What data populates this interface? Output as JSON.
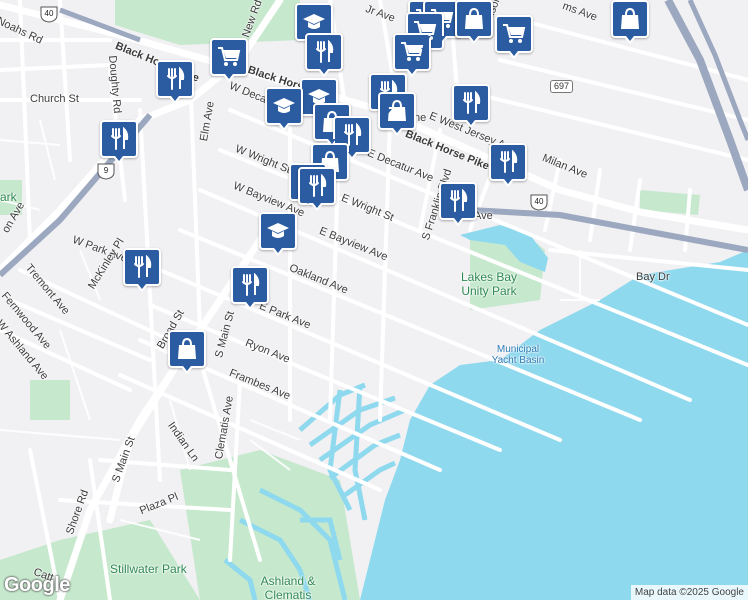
{
  "map": {
    "attribution": "Map data ©2025 Google",
    "logo": "Google",
    "colors": {
      "land": "#f1f0f3",
      "water": "#8ed9ee",
      "park": "#c6e8cd",
      "road": "#ffffff",
      "highway": "#9ba8bf",
      "pin": "#2b5ba0"
    }
  },
  "streets": [
    {
      "id": "s1",
      "text": "Noahs Rd"
    },
    {
      "id": "s2",
      "text": "Church St"
    },
    {
      "id": "s3",
      "text": "Doughty Rd"
    },
    {
      "id": "s4",
      "text": "Black Horse Pike"
    },
    {
      "id": "s5",
      "text": "Black Horse"
    },
    {
      "id": "s6",
      "text": "New Rd"
    },
    {
      "id": "s7",
      "text": "Elm Ave"
    },
    {
      "id": "s8",
      "text": "W Decat"
    },
    {
      "id": "s9",
      "text": "W Wright St"
    },
    {
      "id": "s10",
      "text": "W Bayview Ave"
    },
    {
      "id": "s11",
      "text": "E Decatur Ave"
    },
    {
      "id": "s12",
      "text": "E Wright St"
    },
    {
      "id": "s13",
      "text": "E Bayview Ave"
    },
    {
      "id": "s14",
      "text": "Oakland Ave"
    },
    {
      "id": "s15",
      "text": "E Park Ave"
    },
    {
      "id": "s16",
      "text": "Ryon Ave"
    },
    {
      "id": "s17",
      "text": "Frambes Ave"
    },
    {
      "id": "s18",
      "text": "W Park Ave"
    },
    {
      "id": "s19",
      "text": "Tremont Ave"
    },
    {
      "id": "s20",
      "text": "Fernwood Ave"
    },
    {
      "id": "s21",
      "text": "W Ashland Ave"
    },
    {
      "id": "s22",
      "text": "McKinley Pl"
    },
    {
      "id": "s23",
      "text": "Broad St"
    },
    {
      "id": "s24",
      "text": "S Main St"
    },
    {
      "id": "s25",
      "text": "S Main St"
    },
    {
      "id": "s26",
      "text": "Indian Ln"
    },
    {
      "id": "s27",
      "text": "Clematis Ave"
    },
    {
      "id": "s28",
      "text": "Plaza Pl"
    },
    {
      "id": "s29",
      "text": "Shore Rd"
    },
    {
      "id": "s30",
      "text": "S Franklin Blvd"
    },
    {
      "id": "s31",
      "text": "E West Jersey Ave"
    },
    {
      "id": "s32",
      "text": "Milan Ave"
    },
    {
      "id": "s33",
      "text": "Bay Dr"
    },
    {
      "id": "s34",
      "text": "Black Horse Pike"
    },
    {
      "id": "s35",
      "text": "Madison"
    },
    {
      "id": "s36",
      "text": "Jr Ave"
    },
    {
      "id": "s37",
      "text": "ms Ave"
    },
    {
      "id": "s38",
      "text": "Ave"
    },
    {
      "id": "s39",
      "text": "on Ave"
    },
    {
      "id": "s40",
      "text": "Catt"
    },
    {
      "id": "s41",
      "text": "ne"
    }
  ],
  "places": [
    {
      "id": "p1",
      "text": "Lakes Bay Unity Park",
      "kind": "park"
    },
    {
      "id": "p2",
      "text": "Municipal Yacht Basin",
      "kind": "water"
    },
    {
      "id": "p3",
      "text": "Stillwater Park",
      "kind": "park"
    },
    {
      "id": "p4",
      "text": "Ashland & Clematis",
      "kind": "park"
    },
    {
      "id": "p5",
      "text": "ark",
      "kind": "park"
    }
  ],
  "shields": [
    {
      "id": "h1",
      "text": "40",
      "kind": "us"
    },
    {
      "id": "h2",
      "text": "9",
      "kind": "us"
    },
    {
      "id": "h3",
      "text": "40",
      "kind": "us"
    },
    {
      "id": "h4",
      "text": "697",
      "kind": "state"
    }
  ],
  "pins": [
    {
      "id": "m1",
      "icon": "graduation-cap"
    },
    {
      "id": "m2",
      "icon": "shopping-cart"
    },
    {
      "id": "m3",
      "icon": "shopping-cart"
    },
    {
      "id": "m4",
      "icon": "shopping-cart"
    },
    {
      "id": "m5",
      "icon": "shopping-bag"
    },
    {
      "id": "m6",
      "icon": "shopping-bag"
    },
    {
      "id": "m7",
      "icon": "shopping-cart"
    },
    {
      "id": "m8",
      "icon": "shopping-cart"
    },
    {
      "id": "m9",
      "icon": "fork-knife"
    },
    {
      "id": "m10",
      "icon": "shopping-cart"
    },
    {
      "id": "m11",
      "icon": "shopping-cart"
    },
    {
      "id": "m12",
      "icon": "fork-knife"
    },
    {
      "id": "m13",
      "icon": "graduation-cap"
    },
    {
      "id": "m14",
      "icon": "graduation-cap"
    },
    {
      "id": "m15",
      "icon": "fork-knife"
    },
    {
      "id": "m16",
      "icon": "shopping-bag"
    },
    {
      "id": "m17",
      "icon": "fork-knife"
    },
    {
      "id": "m18",
      "icon": "shopping-bag"
    },
    {
      "id": "m19",
      "icon": "fork-knife"
    },
    {
      "id": "m20",
      "icon": "fork-knife"
    },
    {
      "id": "m21",
      "icon": "shopping-bag"
    },
    {
      "id": "m22",
      "icon": "fork-knife"
    },
    {
      "id": "m23",
      "icon": "fork-knife"
    },
    {
      "id": "m24",
      "icon": "fork-knife"
    },
    {
      "id": "m25",
      "icon": "fork-knife"
    },
    {
      "id": "m26",
      "icon": "graduation-cap"
    },
    {
      "id": "m27",
      "icon": "fork-knife"
    },
    {
      "id": "m28",
      "icon": "fork-knife"
    },
    {
      "id": "m29",
      "icon": "shopping-bag"
    }
  ]
}
